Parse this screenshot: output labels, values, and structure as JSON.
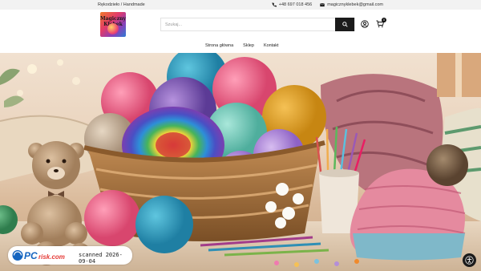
{
  "topbar": {
    "tagline": "Rękodzieło / Handmade",
    "phone": "+48 697 018 456",
    "email": "magicznyklebek@gmail.com"
  },
  "header": {
    "logo_text": "Magiczny Kłębek",
    "search_placeholder": "Szukaj...",
    "cart_count": "0"
  },
  "nav": {
    "items": [
      "Strona główna",
      "Sklep",
      "Kontakt"
    ]
  },
  "watermark": {
    "brand": "PCrisk.com",
    "text": "scanned 2026-09-04"
  },
  "colors": {
    "accent": "#1b1b1b",
    "topbar_bg": "#f2f2f2"
  }
}
